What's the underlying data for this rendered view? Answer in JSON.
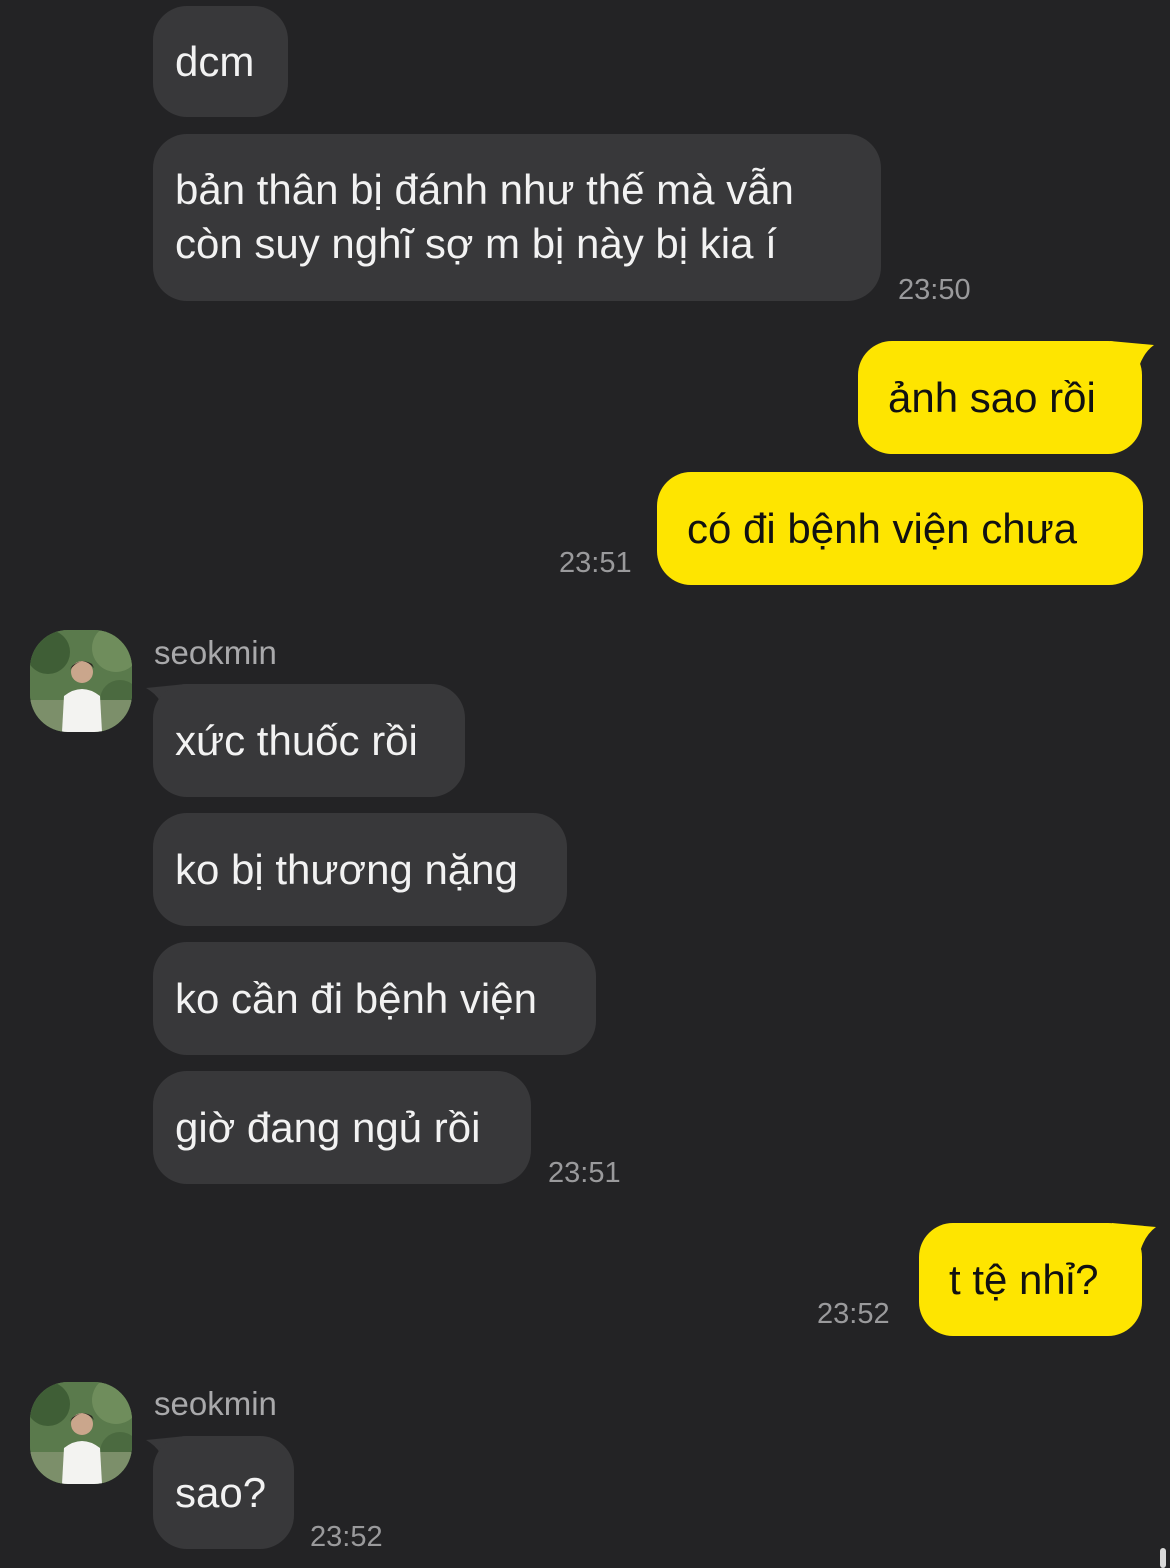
{
  "colors": {
    "background": "#232325",
    "incoming_bubble": "#38383a",
    "outgoing_bubble": "#fee500",
    "timestamp": "#9a9a9c"
  },
  "messages": {
    "m1": "dcm",
    "m2": "bản thân bị đánh như thế mà vẫn còn suy nghĩ sợ m bị này bị kia í",
    "ts1": "23:50",
    "m3": "ảnh sao rồi",
    "m4": "có đi bệnh viện chưa",
    "ts2": "23:51",
    "sender1": "seokmin",
    "m5": "xức thuốc rồi",
    "m6": "ko bị thương nặng",
    "m7": "ko cần đi bệnh viện",
    "m8": "giờ đang ngủ rồi",
    "ts3": "23:51",
    "m9": "t tệ nhỉ?",
    "ts4": "23:52",
    "sender2": "seokmin",
    "m10": "sao?",
    "ts5": "23:52"
  },
  "icons": {
    "avatar": "profile-photo-icon"
  }
}
